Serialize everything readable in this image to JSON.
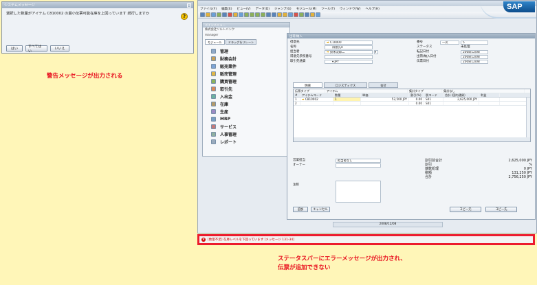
{
  "dialog": {
    "title": "システムメッセージ",
    "message": "選択した数量がアイテム C810002 の最小伝票可能在庫を上回っています 続行しますか",
    "buttons": [
      "はい",
      "すべてはい",
      "いいえ"
    ]
  },
  "callouts": {
    "warning": "警告メッセージが出力される",
    "error_line1": "ステータスバーにエラーメッセージが出力され、",
    "error_line2": "伝票が追加できない"
  },
  "sap": {
    "menu": [
      "ファイル(F)",
      "編集(E)",
      "ビュー(V)",
      "データ(D)",
      "ジャンプ(G)",
      "モジュール(M)",
      "ツール(T)",
      "ウィンドウ(W)",
      "ヘルプ(H)"
    ],
    "logo": "SAP",
    "main_menu": {
      "title": "メインメニュー",
      "company": "株式会社ソルトバンク",
      "user": "manager",
      "tabs": [
        "モジュール",
        "ドラッグ＆リレート"
      ],
      "items": [
        "管理",
        "財務会計",
        "販売業件",
        "販売管理",
        "購買管理",
        "取引先",
        "入出金",
        "在庫",
        "生産",
        "MRP",
        "サービス",
        "人事管理",
        "レポート"
      ]
    },
    "doc": {
      "title": "出荷/納入",
      "fields_left": [
        {
          "label": "得意先",
          "value": "C10000"
        },
        {
          "label": "名称",
          "value": "得意先A"
        },
        {
          "label": "担当者",
          "value": "鈴木次郎二"
        },
        {
          "label": "得意先参照番号",
          "value": ""
        },
        {
          "label": "取引先通貨",
          "value": "JPY"
        }
      ],
      "fields_right": [
        {
          "label": "番号",
          "value": "一次",
          "value2": "5"
        },
        {
          "label": "ステータス",
          "value": "未処理"
        },
        {
          "label": "転記日付",
          "value": "2008/12/08"
        },
        {
          "label": "出荷/納入日付",
          "value": "2008/12/08"
        },
        {
          "label": "伝票日付",
          "value": "2008/12/08"
        }
      ],
      "tabs": [
        "明細",
        "ロジスティクス",
        "会計"
      ],
      "item_type_label": "伝票タイプ",
      "item_type_value": "アイテム",
      "summary_type_label": "集計タイプ",
      "summary_type_value": "集計なし",
      "grid_headers": [
        "#",
        "アイテムコード",
        "数量",
        "単価",
        "割引(%)",
        "税コード",
        "合計 (国内通貨)",
        "利益"
      ],
      "rows": [
        [
          "1",
          "C810002",
          "1",
          "52,500 JPY",
          "0.00",
          "S01",
          "2,625,000 JPY",
          ""
        ],
        [
          "2",
          "",
          "",
          "",
          "0.00",
          "S01",
          "",
          ""
        ]
      ],
      "sales_rep_label": "営業担当",
      "sales_rep_value": "担当者なし",
      "owner_label": "オーナー",
      "remarks_label": "注釈",
      "totals": [
        {
          "label": "割引前合計",
          "value": "2,625,000 JPY"
        },
        {
          "label": "割引",
          "value": "%"
        },
        {
          "label": "端数処理",
          "value": "0 JPY"
        },
        {
          "label": "税額",
          "value": "131,250 JPY"
        },
        {
          "label": "合計",
          "value": "2,756,250 JPY"
        }
      ],
      "buttons": {
        "add": "追加",
        "cancel": "キャンセル",
        "copy_from": "コピー元",
        "copy_to": "コピー先"
      }
    },
    "footer_date": "2008/12/08",
    "status_message": "[数量不足] 在庫レベルを下回っています [メッセージ 131-34]"
  },
  "colors": {
    "accent_red": "#e8101f",
    "status_red": "#ec1b2d",
    "background": "#fff6b8"
  }
}
